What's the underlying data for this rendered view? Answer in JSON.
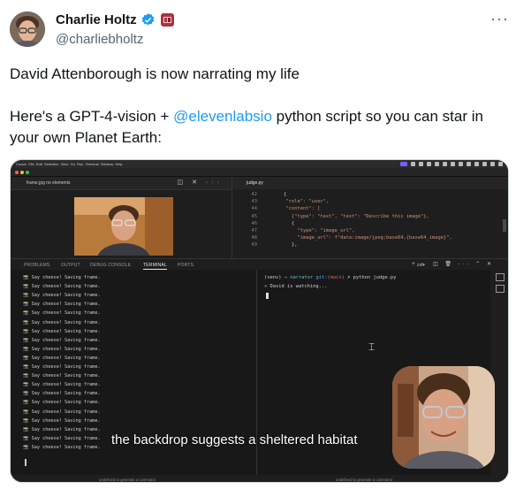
{
  "author": {
    "display_name": "Charlie Holtz",
    "handle": "@charliebholtz"
  },
  "colors": {
    "link": "#1d9bf0",
    "verified": "#1d9bf0"
  },
  "tweet": {
    "line1": "David Attenborough is now narrating my life",
    "line2_prefix": "Here's a GPT-4-vision + ",
    "line2_mention": "@elevenlabsio",
    "line2_suffix": " python script so you can star in your own Planet Earth:"
  },
  "menu_icon": "more-dots-icon",
  "media": {
    "left_tab": "frame.jpg  no elements",
    "right_tab": "judge.py",
    "code_lines": [
      {
        "n": "42",
        "text": "{"
      },
      {
        "n": "43",
        "text": "  \"role\": \"user\","
      },
      {
        "n": "44",
        "text": "  \"content\": ["
      },
      {
        "n": "45",
        "text": "    {\"type\": \"text\", \"text\": \"Describe this image\"},"
      },
      {
        "n": "46",
        "text": "    {"
      },
      {
        "n": "47",
        "text": "      \"type\": \"image_url\","
      },
      {
        "n": "48",
        "text": "      \"image_url\": f\"data:image/jpeg;base64,{base64_image}\","
      },
      {
        "n": "49",
        "text": "    },"
      }
    ],
    "panel_tabs": [
      "PROBLEMS",
      "OUTPUT",
      "DEBUG CONSOLE",
      "TERMINAL",
      "PORTS"
    ],
    "shell_label": "zsh",
    "saving_line": "📸 Say cheese! Saving frame.",
    "prompt": {
      "env": "(venv)",
      "arrow": "→",
      "dir": "narrator",
      "git": "git:(",
      "branch": "main",
      "git_close": ")",
      "mark": "✗",
      "cmd": "python judge.py"
    },
    "watching": "» David is watching...",
    "hint_left": "undefined to generate a command",
    "hint_right": "undefined to generate a command",
    "caption": "the backdrop suggests a sheltered habitat"
  }
}
